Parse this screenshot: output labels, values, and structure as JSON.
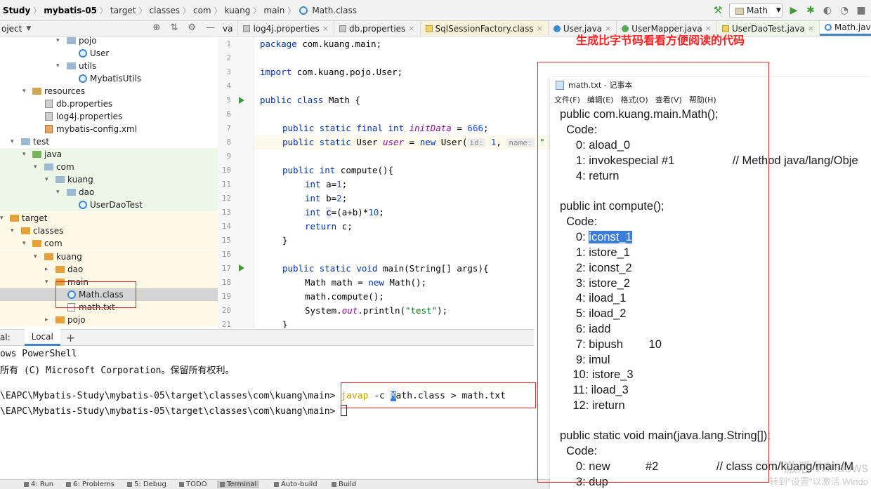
{
  "breadcrumb": {
    "items": [
      "Study",
      "mybatis-05",
      "target",
      "classes",
      "com",
      "kuang",
      "main",
      "Math.class"
    ]
  },
  "toolbar": {
    "run_config": "Math",
    "dropdown_arrow": "▼"
  },
  "project_header": {
    "title": "oject",
    "dropdown_arrow": "▼"
  },
  "tabs": [
    {
      "label": "va",
      "icon": "none",
      "closable": false
    },
    {
      "label": "log4j.properties",
      "icon": "props",
      "closable": true
    },
    {
      "label": "db.properties",
      "icon": "props",
      "closable": true
    },
    {
      "label": "SqlSessionFactory.class",
      "icon": "gold",
      "closable": true
    },
    {
      "label": "User.java",
      "icon": "java",
      "closable": true
    },
    {
      "label": "UserMapper.java",
      "icon": "iface",
      "closable": true
    },
    {
      "label": "UserDaoTest.java",
      "icon": "gold",
      "closable": true
    },
    {
      "label": "Math.java",
      "icon": "class",
      "closable": true,
      "active": true
    }
  ],
  "tree": [
    {
      "label": "pojo",
      "arrow": "▾",
      "kind": "pkg",
      "zone": ""
    },
    {
      "label": "User",
      "arrow": "",
      "kind": "class",
      "zone": ""
    },
    {
      "label": "utils",
      "arrow": "▾",
      "kind": "pkg",
      "zone": ""
    },
    {
      "label": "MybatisUtils",
      "arrow": "",
      "kind": "class",
      "zone": ""
    },
    {
      "label": "resources",
      "arrow": "▾",
      "kind": "res",
      "zone": ""
    },
    {
      "label": "db.properties",
      "arrow": "",
      "kind": "props",
      "zone": ""
    },
    {
      "label": "log4j.properties",
      "arrow": "",
      "kind": "props",
      "zone": ""
    },
    {
      "label": "mybatis-config.xml",
      "arrow": "",
      "kind": "xml",
      "zone": ""
    },
    {
      "label": "test",
      "arrow": "▾",
      "kind": "pkg",
      "zone": ""
    },
    {
      "label": "java",
      "arrow": "▾",
      "kind": "green",
      "zone": "test"
    },
    {
      "label": "com",
      "arrow": "▾",
      "kind": "pkg",
      "zone": "test"
    },
    {
      "label": "kuang",
      "arrow": "▾",
      "kind": "pkg",
      "zone": "test"
    },
    {
      "label": "dao",
      "arrow": "▾",
      "kind": "pkg",
      "zone": "test"
    },
    {
      "label": "UserDaoTest",
      "arrow": "",
      "kind": "class",
      "zone": "test"
    },
    {
      "label": "target",
      "arrow": "▾",
      "kind": "orange",
      "zone": "target"
    },
    {
      "label": "classes",
      "arrow": "▾",
      "kind": "orange",
      "zone": "target"
    },
    {
      "label": "com",
      "arrow": "▾",
      "kind": "orange",
      "zone": "target"
    },
    {
      "label": "kuang",
      "arrow": "▾",
      "kind": "orange",
      "zone": "target"
    },
    {
      "label": "dao",
      "arrow": "▸",
      "kind": "orange",
      "zone": "target"
    },
    {
      "label": "main",
      "arrow": "▾",
      "kind": "orange",
      "zone": "target"
    },
    {
      "label": "Math.class",
      "arrow": "",
      "kind": "class",
      "zone": "selected"
    },
    {
      "label": "math.txt",
      "arrow": "",
      "kind": "txt",
      "zone": "target"
    },
    {
      "label": "pojo",
      "arrow": "▸",
      "kind": "orange",
      "zone": "target"
    }
  ],
  "editor": {
    "line_numbers": [
      "1",
      "2",
      "3",
      "4",
      "5",
      "6",
      "7",
      "8",
      "9",
      "10",
      "11",
      "12",
      "13",
      "14",
      "15",
      "16",
      "17",
      "18",
      "19",
      "20",
      "21"
    ],
    "lines": {
      "l1_kw": "package",
      "l1_rest": " com.kuang.main;",
      "l3_kw": "import",
      "l3_rest": " com.kuang.pojo.User;",
      "l5_kw": "public class",
      "l5_rest": " Math {",
      "l7_kw": "public static final int",
      "l7_field": "initData",
      "l7_eq": " = ",
      "l7_num": "666",
      "l7_end": ";",
      "l8_kw": "public static",
      "l8_type": " User ",
      "l8_field": "user",
      "l8_eq": " = ",
      "l8_new": "new",
      "l8_ctor": " User(",
      "l8_hint1": "id:",
      "l8_num": " 1",
      "l8_comma": ", ",
      "l8_hint2": "name:",
      "l8_str": " \"",
      "l10_kw": "public int",
      "l10_rest": " compute(){",
      "l11_kw": "int",
      "l11_rest": " a=",
      "l11_num": "1",
      "l11_end": ";",
      "l12_kw": "int",
      "l12_rest": " b=",
      "l12_num": "2",
      "l12_end": ";",
      "l13_kw": "int",
      "l13_var": "c",
      "l13_rest": "=(a+b)*",
      "l13_num": "10",
      "l13_end": ";",
      "l14_kw": "return",
      "l14_rest": " c;",
      "l15": "}",
      "l17_kw": "public static void",
      "l17_rest": " main(String[] args){",
      "l18_pre": "Math math = ",
      "l18_kw": "new",
      "l18_rest": " Math();",
      "l19": "math.compute();",
      "l20_pre": "System.",
      "l20_field": "out",
      "l20_mid": ".println(",
      "l20_str": "\"test\"",
      "l20_end": ");",
      "l21": "}"
    }
  },
  "terminal": {
    "header_label": "al:",
    "tab_label": "Local",
    "add": "+",
    "line1": "ows PowerShell",
    "line2": "所有 (C) Microsoft Corporation。保留所有权利。",
    "line3_path": "\\EAPC\\Mybatis-Study\\mybatis-05\\target\\classes\\com\\kuang\\main> ",
    "line3_cmd_kw": "javap",
    "line3_cmd_pre": " -c ",
    "line3_cmd_hl": "M",
    "line3_cmd_rest": "ath.class > math.txt",
    "line4_path": "\\EAPC\\Mybatis-Study\\mybatis-05\\target\\classes\\com\\kuang\\main> "
  },
  "bottom_bar": [
    {
      "label": "4: Run",
      "active": false
    },
    {
      "label": "6: Problems",
      "active": false
    },
    {
      "label": "5: Debug",
      "active": false
    },
    {
      "label": "TODO",
      "active": false
    },
    {
      "label": "Terminal",
      "active": true
    },
    {
      "label": "Auto-build",
      "active": false
    },
    {
      "label": "Build",
      "active": false
    }
  ],
  "annotation": "生成比字节码看看方便阅读的代码",
  "notepad": {
    "title": "math.txt - 记事本",
    "menu": [
      "文件(F)",
      "编辑(E)",
      "格式(O)",
      "查看(V)",
      "帮助(H)"
    ],
    "lines": [
      "public com.kuang.main.Math();",
      "  Code:",
      "     0: aload_0",
      "     1: invokespecial #1                  // Method java/lang/Obje",
      "     4: return",
      "",
      "public int compute();",
      "  Code:",
      "     0: ",
      "     1: istore_1",
      "     2: iconst_2",
      "     3: istore_2",
      "     4: iload_1",
      "     5: iload_2",
      "     6: iadd",
      "     7: bipush        10",
      "     9: imul",
      "    10: istore_3",
      "    11: iload_3",
      "    12: ireturn",
      "",
      "public static void main(java.lang.String[]);",
      "  Code:",
      "     0: new           #2                  // class com/kuang/main/M",
      "     3: dup"
    ],
    "selected_text": "iconst_1"
  },
  "watermark": {
    "line1": "激活 Windows",
    "line2": "转到\"设置\"以激活 Windo"
  },
  "colors": {
    "accent": "#4083c9",
    "annotation_red": "#ff2222",
    "keyword": "#0033b3",
    "selection": "#3b7dd8"
  }
}
